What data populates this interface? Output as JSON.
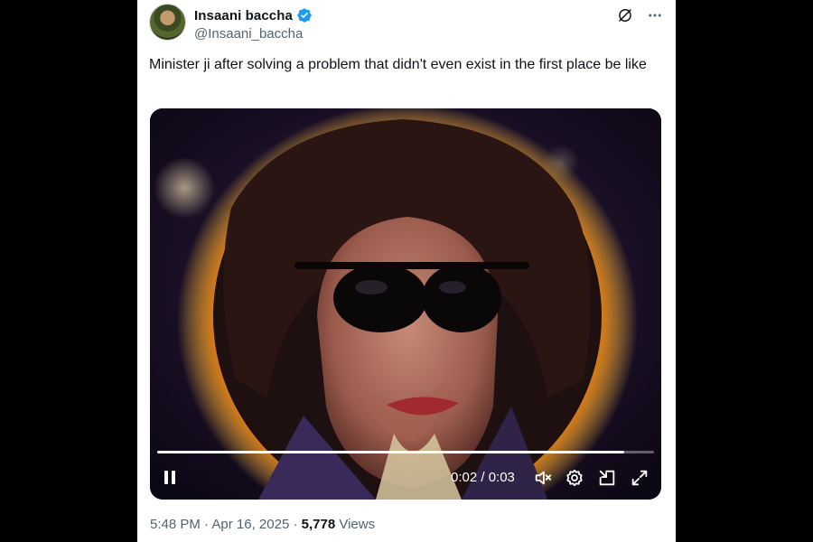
{
  "author": {
    "display_name": "Insaani baccha",
    "handle": "@Insaani_baccha",
    "verified": true
  },
  "icons": {
    "verified": "verified-badge-icon",
    "grok": "grok-icon",
    "more": "more-options-icon",
    "pause": "pause-icon",
    "mute": "mute-icon",
    "settings": "gear-icon",
    "pip": "picture-in-picture-icon",
    "fullscreen": "fullscreen-icon"
  },
  "tweet": {
    "text": "Minister ji after solving a problem that didn't even exist in the first place be like"
  },
  "video": {
    "current_time": "0:02",
    "duration": "0:03",
    "time_display": "0:02 / 0:03",
    "progress_fraction": 0.94
  },
  "meta": {
    "time": "5:48 PM",
    "date": "Apr 16, 2025",
    "separator": "·",
    "views_count": "5,778",
    "views_label": "Views"
  },
  "colors": {
    "verified_blue": "#1d9bf0",
    "text_primary": "#0f1419",
    "text_secondary": "#536471",
    "background": "#ffffff"
  }
}
